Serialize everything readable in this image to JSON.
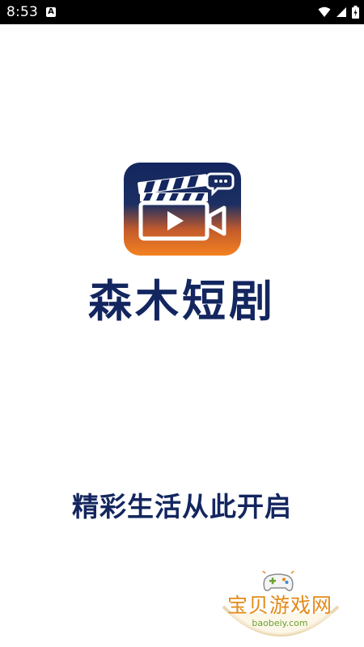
{
  "status_bar": {
    "time": "8:53",
    "notification_icon": "A",
    "icons": [
      "wifi-icon",
      "signal-icon",
      "battery-icon"
    ]
  },
  "splash": {
    "app_name": "森木短剧",
    "slogan": "精彩生活从此开启",
    "logo_icon": "clapperboard-camera-icon"
  },
  "watermark": {
    "text": "宝贝游戏网",
    "url": "baobeiy.com",
    "icon": "gamepad-icon"
  },
  "colors": {
    "brand_navy": "#13265f",
    "brand_orange": "#f07a1f",
    "watermark_orange": "#e38a19",
    "watermark_green": "#6aa12f"
  }
}
